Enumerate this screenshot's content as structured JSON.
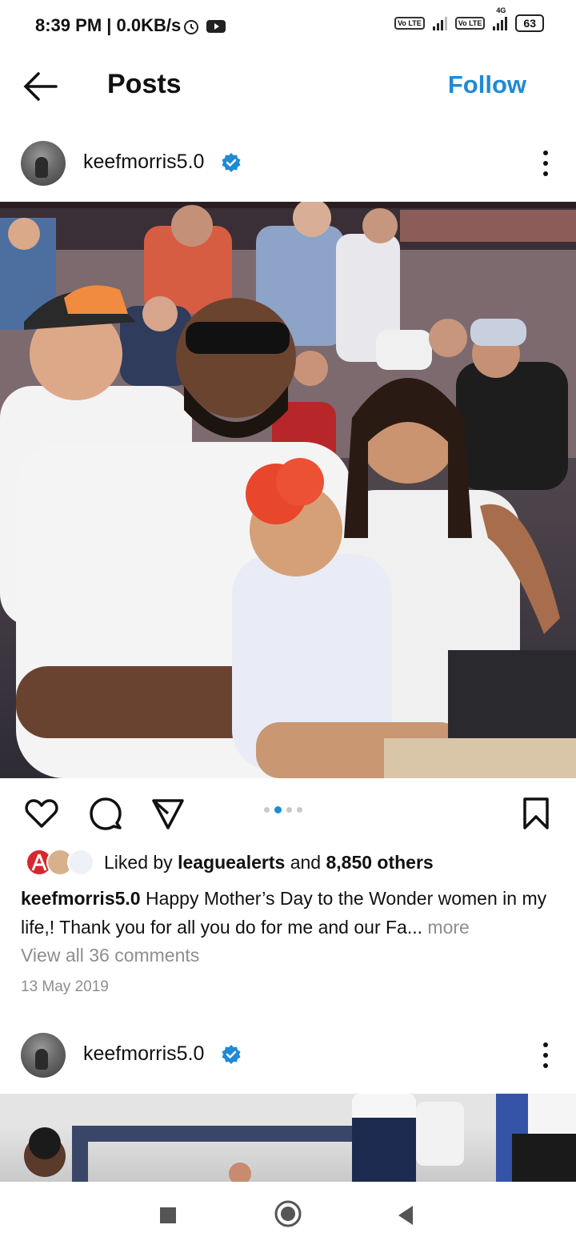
{
  "status_bar": {
    "time": "8:39 PM | 0.0KB/s",
    "volte1": "Vo LTE",
    "volte2": "Vo LTE",
    "network": "4G",
    "battery": "63"
  },
  "header": {
    "title": "Posts",
    "follow_label": "Follow"
  },
  "post": {
    "username": "keefmorris5.0",
    "likes": {
      "prefix": "Liked by ",
      "user": "leaguealerts",
      "middle": " and ",
      "count": "8,850 others"
    },
    "caption": {
      "username": "keefmorris5.0",
      "text": " Happy Mother’s Day to the Wonder women in my life,! Thank you for all you do for me and our Fa",
      "ellipsis": "...",
      "more_label": " more"
    },
    "view_comments": "View all 36 comments",
    "date": "13 May 2019",
    "carousel": {
      "count": 4,
      "active_index": 1
    }
  },
  "next_post": {
    "username": "keefmorris5.0"
  },
  "colors": {
    "accent": "#1f8ad6",
    "muted": "#8e8e8e",
    "verified": "#1f8ad6"
  },
  "icons": {
    "back": "arrow-left-icon",
    "verified": "verified-badge-icon",
    "more": "more-vertical-icon",
    "like": "heart-icon",
    "comment": "comment-icon",
    "share": "send-icon",
    "save": "bookmark-icon",
    "nav_recent": "square-icon",
    "nav_home": "circle-icon",
    "nav_back": "triangle-back-icon"
  }
}
